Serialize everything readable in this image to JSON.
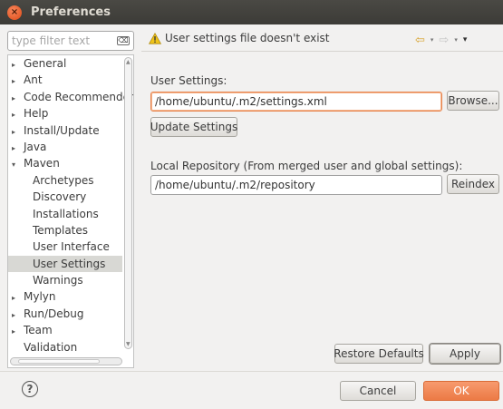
{
  "window": {
    "title": "Preferences",
    "close_glyph": "×"
  },
  "filter": {
    "placeholder": "type filter text",
    "clear_glyph": "⌫"
  },
  "tree": {
    "items": [
      {
        "label": "General",
        "expander": "▸"
      },
      {
        "label": "Ant",
        "expander": "▸"
      },
      {
        "label": "Code Recommender",
        "expander": "▸"
      },
      {
        "label": "Help",
        "expander": "▸"
      },
      {
        "label": "Install/Update",
        "expander": "▸"
      },
      {
        "label": "Java",
        "expander": "▸"
      },
      {
        "label": "Maven",
        "expander": "▾"
      },
      {
        "label": "Archetypes"
      },
      {
        "label": "Discovery"
      },
      {
        "label": "Installations"
      },
      {
        "label": "Templates"
      },
      {
        "label": "User Interface"
      },
      {
        "label": "User Settings",
        "selected": true
      },
      {
        "label": "Warnings"
      },
      {
        "label": "Mylyn",
        "expander": "▸"
      },
      {
        "label": "Run/Debug",
        "expander": "▸"
      },
      {
        "label": "Team",
        "expander": "▸"
      },
      {
        "label": "Validation"
      }
    ]
  },
  "header": {
    "message": "User settings file doesn't exist",
    "warning_icon": "warning-icon",
    "nav": {
      "back": "⇦",
      "forward": "⇨",
      "dropdown": "▾",
      "menu": "▾"
    }
  },
  "content": {
    "user_settings_label": "User Settings:",
    "user_settings_value": "/home/ubuntu/.m2/settings.xml",
    "browse_label": "Browse...",
    "update_settings_label": "Update Settings",
    "local_repo_label": "Local Repository (From merged user and global settings):",
    "local_repo_value": "/home/ubuntu/.m2/repository",
    "reindex_label": "Reindex"
  },
  "actions": {
    "restore_defaults_label": "Restore Defaults",
    "apply_label": "Apply",
    "cancel_label": "Cancel",
    "ok_label": "OK",
    "help_glyph": "?"
  },
  "colors": {
    "accent": "#ec7a45",
    "titlebar": "#3c3b37",
    "warning": "#f0c419"
  }
}
